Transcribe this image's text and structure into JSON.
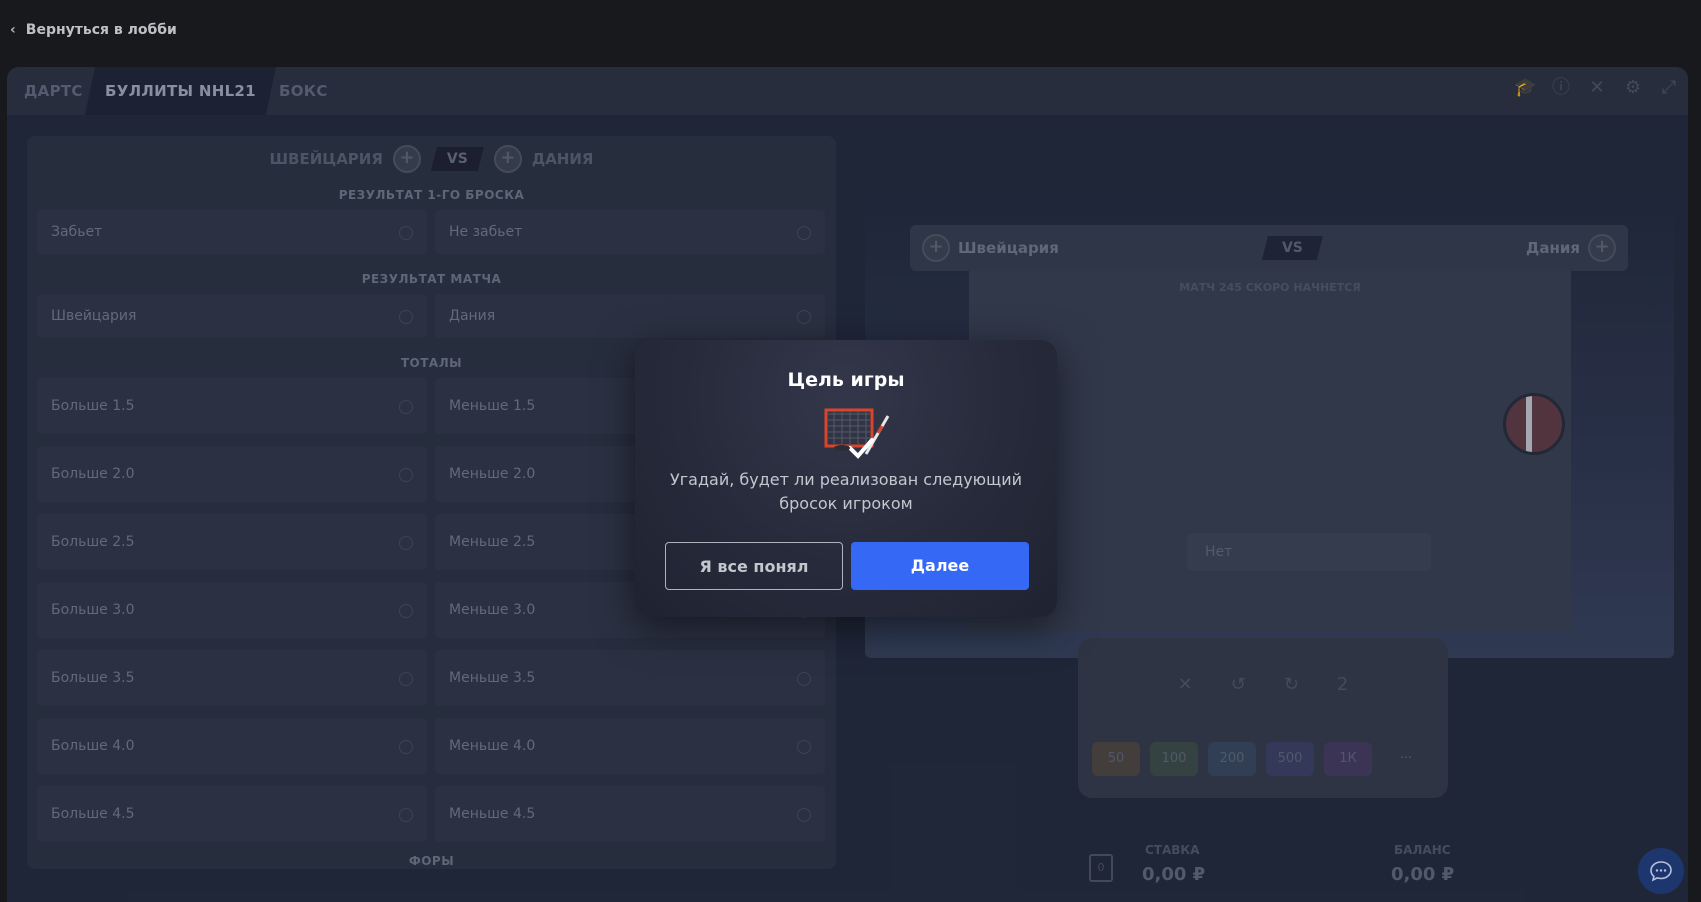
{
  "back": {
    "label": "Вернуться в лобби"
  },
  "tabs": [
    "ДАРТС",
    "БУЛЛИТЫ NHL21",
    "БОКС"
  ],
  "tools": [
    "graduation-cap-icon",
    "info-icon",
    "sound-off-icon",
    "gear-icon",
    "fullscreen-icon"
  ],
  "bets": {
    "team1": "ШВЕЙЦАРИЯ",
    "team2": "ДАНИЯ",
    "vs": "VS",
    "sections": {
      "first_shot": "РЕЗУЛЬТАТ 1-ГО БРОСКА",
      "match_result": "РЕЗУЛЬТАТ МАТЧА",
      "totals": "ТОТАЛЫ",
      "handicaps": "ФОРЫ"
    },
    "first_shot": [
      "Забьет",
      "Не забьет"
    ],
    "match_result": [
      "Швейцария",
      "Дания"
    ],
    "totals": [
      [
        "Больше 1.5",
        "Меньше 1.5"
      ],
      [
        "Больше 2.0",
        "Меньше 2.0"
      ],
      [
        "Больше 2.5",
        "Меньше 2.5"
      ],
      [
        "Больше 3.0",
        "Меньше 3.0"
      ],
      [
        "Больше 3.5",
        "Меньше 3.5"
      ],
      [
        "Больше 4.0",
        "Меньше 4.0"
      ],
      [
        "Больше 4.5",
        "Меньше 4.5"
      ]
    ]
  },
  "arena": {
    "team1": "Швейцария",
    "team2": "Дания",
    "vs": "VS",
    "status": "МАТЧ 245 СКОРО НАЧНЕТСЯ",
    "no_label": "Нет"
  },
  "betbox": {
    "chips": [
      "50",
      "100",
      "200",
      "500",
      "1К"
    ],
    "more": "···",
    "multiplier": "2"
  },
  "footer": {
    "stake_label": "СТАВКА",
    "stake_value": "0,00 ₽",
    "balance_label": "БАЛАНС",
    "balance_value": "0,00 ₽",
    "wallet_digit": "0"
  },
  "modal": {
    "title": "Цель игры",
    "text": "Угадай, будет ли реализован следующий бросок игроком",
    "ok_label": "Я все понял",
    "next_label": "Далее"
  },
  "colors": {
    "primary": "#3468f5",
    "background": "#1a1b1e"
  }
}
